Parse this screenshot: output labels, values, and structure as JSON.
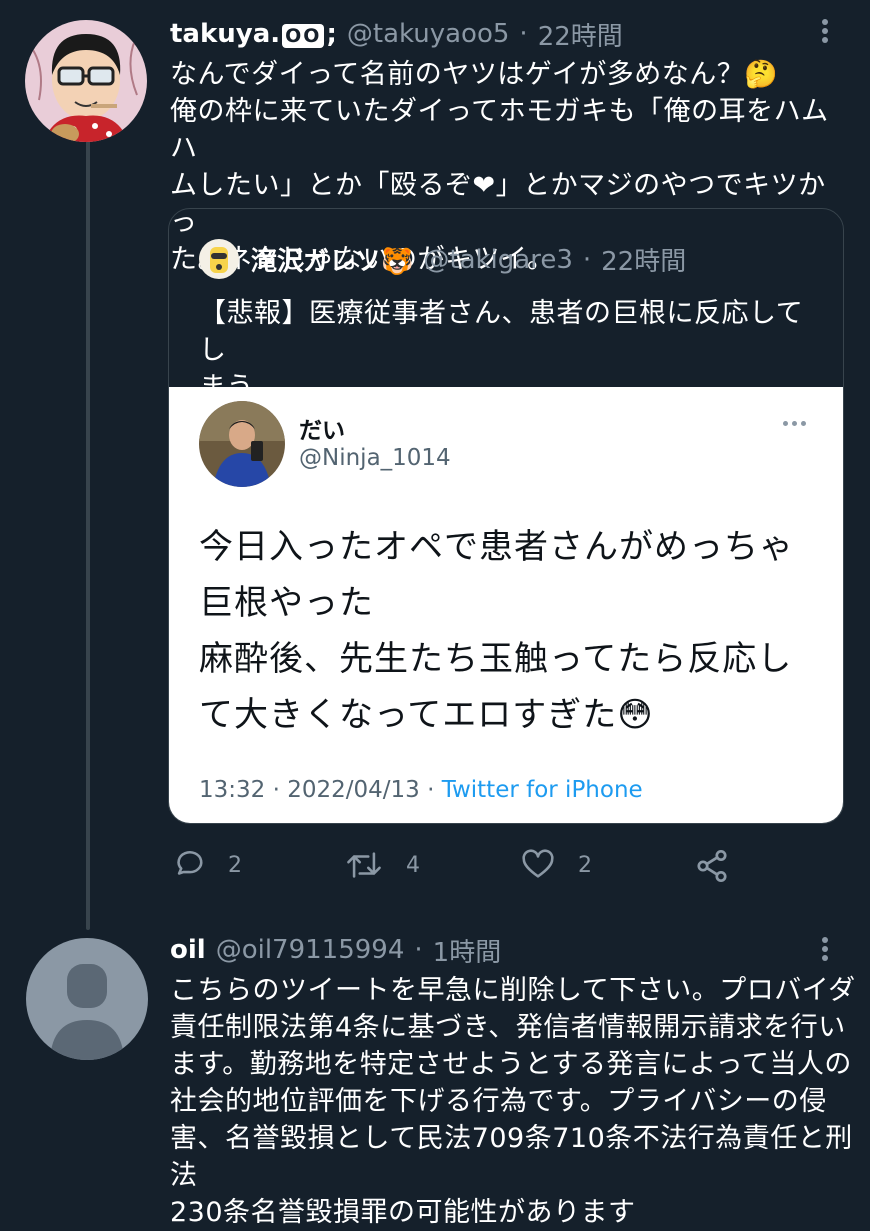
{
  "tweet1": {
    "display_name": "takuya.",
    "name_badges": "OO",
    "name_suffix": ";",
    "handle": "@takuyaoo5",
    "time": "22時間",
    "lines": [
      "なんでダイって名前のヤツはゲイが多めなん？🤔",
      "俺の枠に来ていたダイってホモガキも「俺の耳をハムハ",
      "ムしたい」とか「殴るぞ❤」とかマジのやつでキツかっ",
      "た。ネタじゃないのがキツイ。"
    ],
    "quote": {
      "display_name": "滝沢ガレソ🐯",
      "handle": "@takigare3",
      "time": "22時間",
      "lines": [
        "【悲報】医療従事者さん、患者の巨根に反応してし",
        "まう"
      ],
      "embedded": {
        "display_name": "だい",
        "handle": "@Ninja_1014",
        "lines": [
          "今日入ったオペで患者さんがめっちゃ",
          "巨根やった",
          "麻酔後、先生たち玉触ってたら反応し",
          "て大きくなってエロすぎた😳"
        ],
        "timestamp": "13:32 · 2022/04/13 · ",
        "source": "Twitter for iPhone"
      }
    },
    "actions": {
      "reply_count": "2",
      "retweet_count": "4",
      "like_count": "2"
    }
  },
  "tweet2": {
    "display_name": "oil",
    "handle": "@oil79115994",
    "time": "1時間",
    "lines": [
      "こちらのツイートを早急に削除して下さい。プロバイダ",
      "責任制限法第4条に基づき、発信者情報開示請求を行い",
      "ます。勤務地を特定させようとする発言によって当人の",
      "社会的地位評価を下げる行為です。プライバシーの侵",
      "害、名誉毀損として民法709条710条不法行為責任と刑法",
      "230条名誉毀損罪の可能性があります"
    ]
  },
  "colors": {
    "background": "#15202b",
    "muted": "#8b98a5",
    "link": "#1d9bf0",
    "border": "#38444d"
  },
  "icons": [
    "more-icon",
    "reply-icon",
    "retweet-icon",
    "like-icon",
    "share-icon",
    "default-avatar-icon"
  ]
}
